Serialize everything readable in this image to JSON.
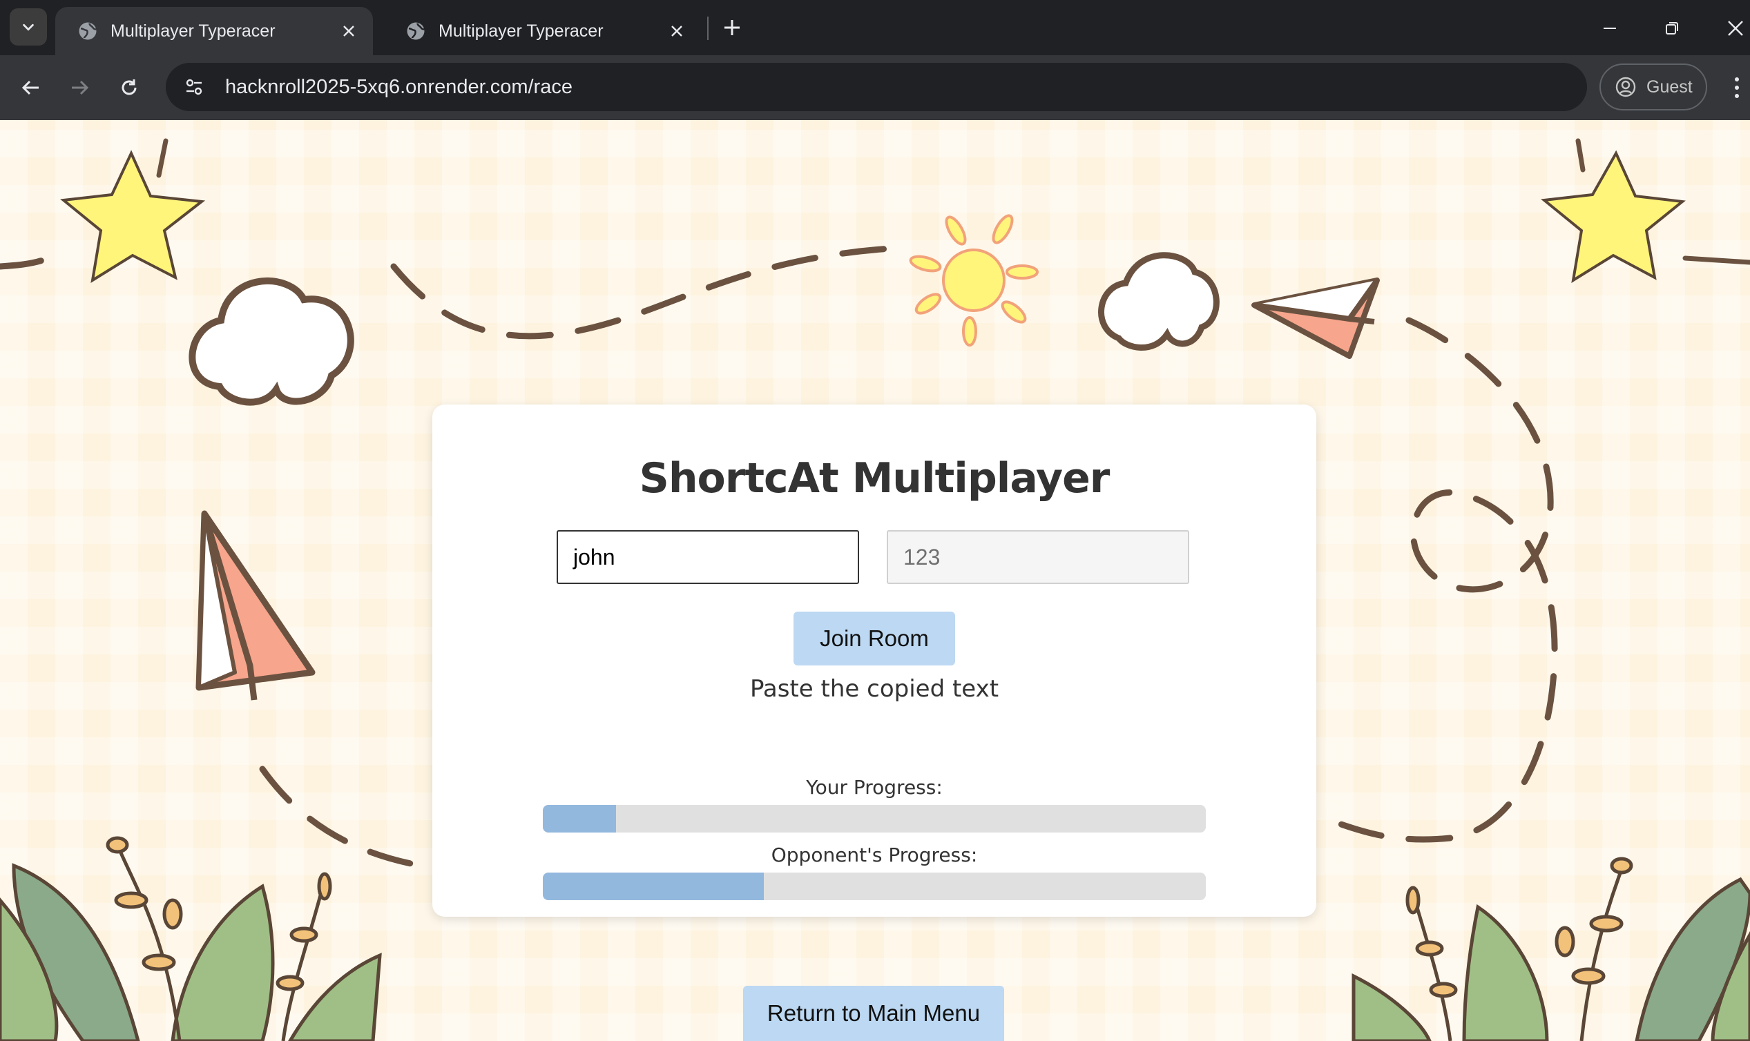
{
  "browser": {
    "tabs": [
      {
        "title": "Multiplayer Typeracer",
        "active": true
      },
      {
        "title": "Multiplayer Typeracer",
        "active": false
      }
    ],
    "address": "hacknroll2025-5xq6.onrender.com/race",
    "profile_label": "Guest"
  },
  "page": {
    "heading": "ShortcAt Multiplayer",
    "name_input_value": "john",
    "room_input_value": "123",
    "join_button_label": "Join Room",
    "instruction": "Paste the copied text",
    "your_progress_label": "Your Progress:",
    "your_progress_fraction": 0.11,
    "opponent_progress_label": "Opponent's Progress:",
    "opponent_progress_fraction": 0.333,
    "return_button_label": "Return to Main Menu"
  },
  "colors": {
    "progress_fill": "#93b8de",
    "progress_track": "#e0e0e0",
    "button_bg": "#bcd8f2",
    "page_bg": "#fdf3df",
    "decor_line": "#6b5240",
    "star": "#fff57a",
    "plane": "#f7a58d",
    "leaf": "#9fbf86"
  }
}
